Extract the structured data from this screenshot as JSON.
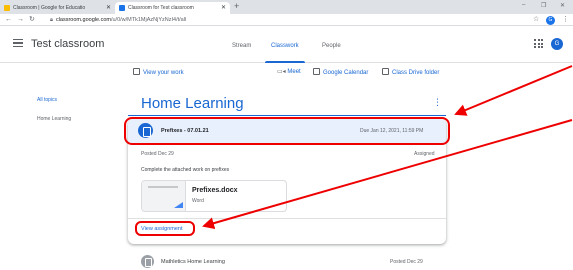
{
  "browser": {
    "tabs": [
      {
        "title": "Classroom | Google for Educatio"
      },
      {
        "title": "Classroom for Test classroom"
      }
    ],
    "new_tab": "+",
    "url_host": "classroom.google.com",
    "url_path": "/u/0/w/MTk1MjAzNjYzNzI4/t/all",
    "profile_initial": "G"
  },
  "header": {
    "title": "Test classroom",
    "nav": [
      "Stream",
      "Classwork",
      "People"
    ],
    "active_nav": "Classwork",
    "avatar_initial": "G"
  },
  "links": {
    "view_work": "View your work",
    "meet": "Meet",
    "calendar": "Google Calendar",
    "drive": "Class Drive folder"
  },
  "topics": [
    "All topics",
    "Home Learning"
  ],
  "section": {
    "title": "Home Learning",
    "assignment": {
      "title": "Prefixes - 07.01.21",
      "due": "Due Jan 12, 2021, 11:59 PM",
      "posted": "Posted Dec 29",
      "status": "Assigned",
      "instructions": "Complete the attached work on prefixes",
      "attachment": {
        "name": "Prefixes.docx",
        "type": "Word"
      },
      "view_label": "View assignment"
    },
    "next_item": {
      "title": "Mathletics Home Learning",
      "posted": "Posted Dec 29"
    }
  },
  "annotation_color": "#e00000"
}
